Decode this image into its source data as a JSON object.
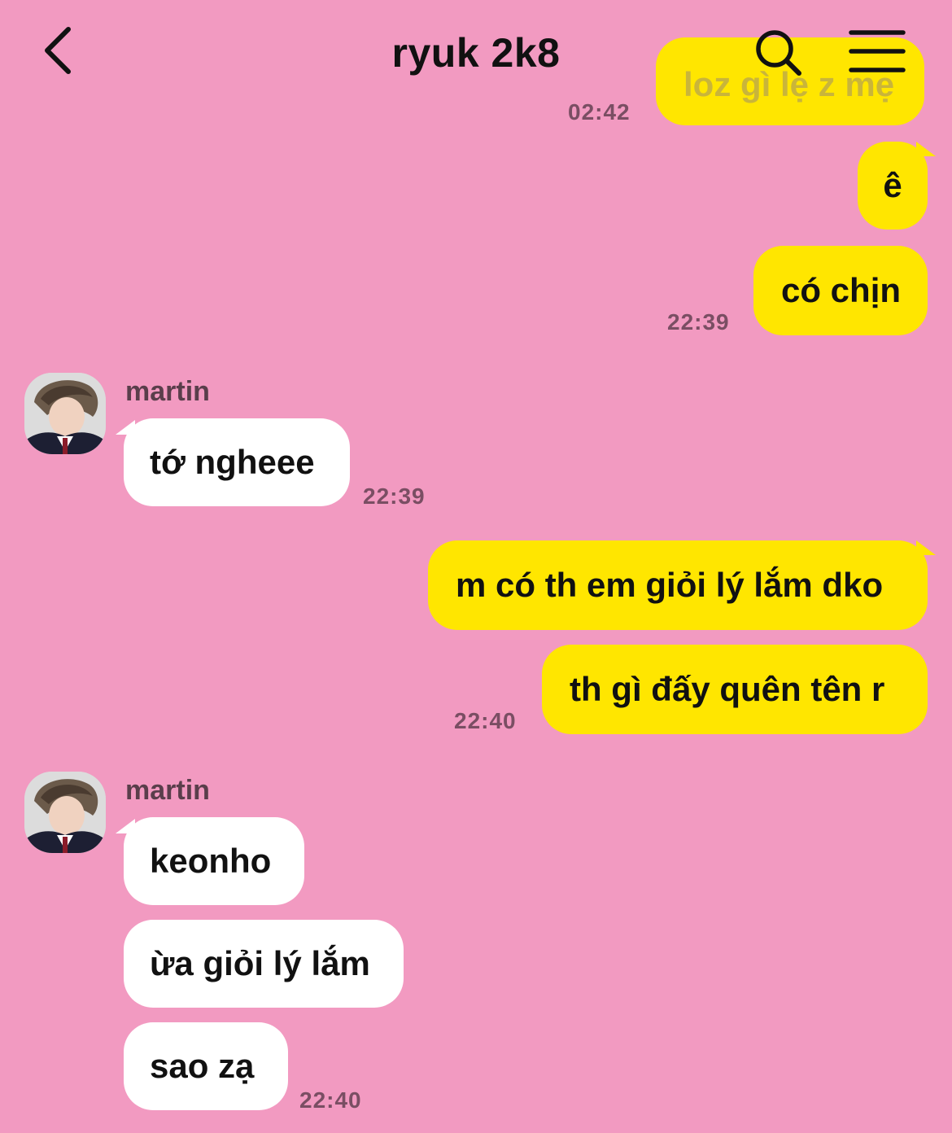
{
  "header": {
    "title": "ryuk 2k8"
  },
  "messages": {
    "m0": {
      "text": "loz gì lẹ z mẹ",
      "time": "02:42"
    },
    "m1": {
      "text": "ê"
    },
    "m2": {
      "text": "có chịn",
      "time": "22:39"
    },
    "g1": {
      "sender": "martin",
      "m1": {
        "text": "tớ ngheee",
        "time": "22:39"
      }
    },
    "m3": {
      "text": "m có th em giỏi lý lắm dko"
    },
    "m4": {
      "text": "th gì đấy quên tên r",
      "time": "22:40"
    },
    "g2": {
      "sender": "martin",
      "m1": {
        "text": "keonho"
      },
      "m2": {
        "text": "ừa giỏi lý lắm"
      },
      "m3": {
        "text": "sao zạ",
        "time": "22:40"
      }
    }
  },
  "colors": {
    "background": "#F29AC1",
    "outgoing_bubble": "#FFE600",
    "incoming_bubble": "#FFFFFF"
  }
}
